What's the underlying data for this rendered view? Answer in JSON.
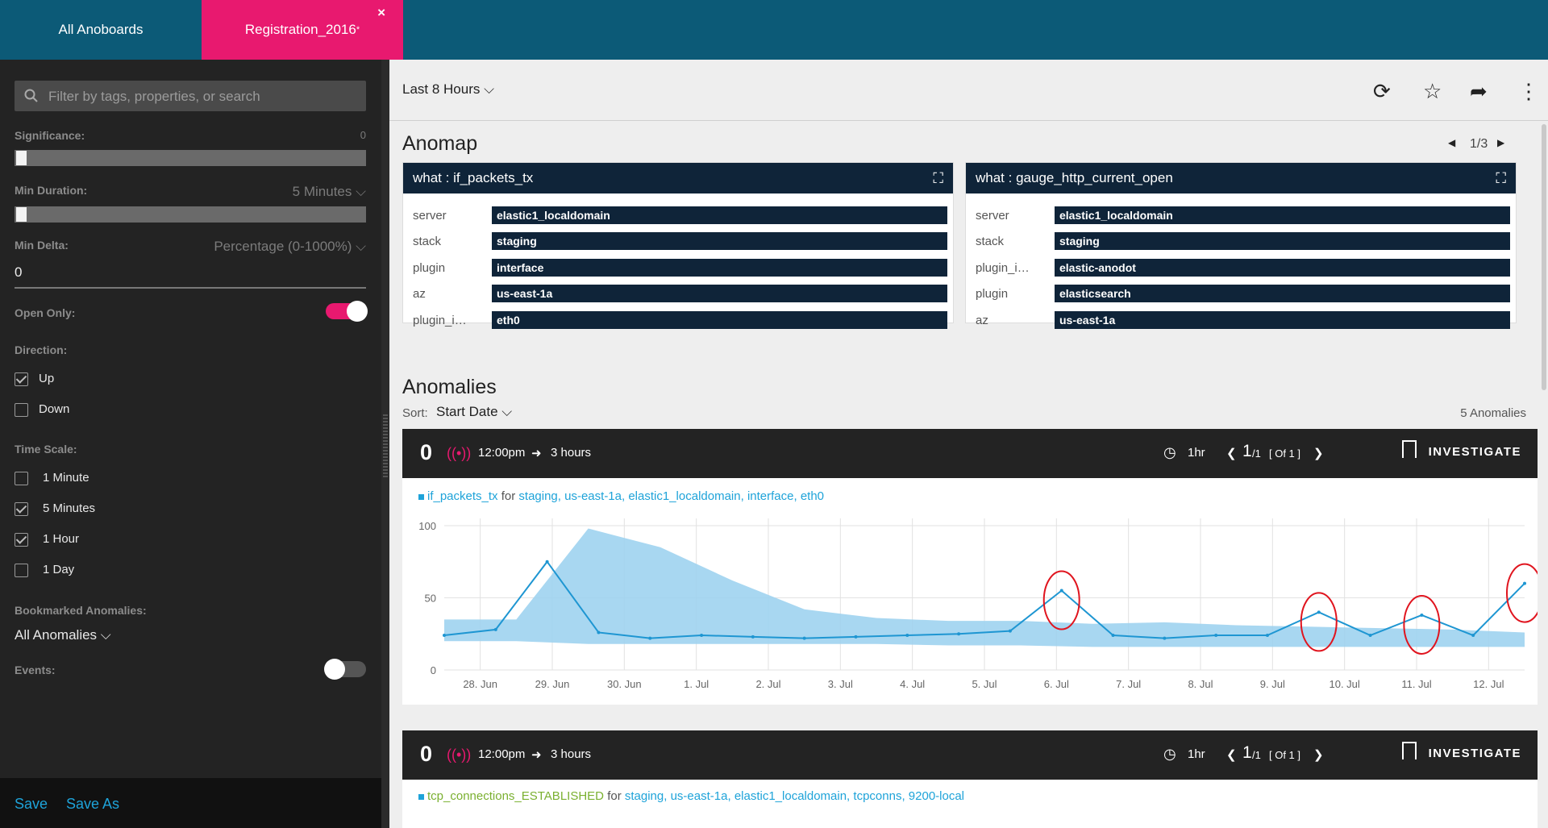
{
  "tabs": {
    "all": "All Anoboards",
    "current": "Registration_2016",
    "current_marker": "*",
    "close": "×"
  },
  "sidebar": {
    "search_placeholder": "Filter by tags, properties, or search",
    "significance_label": "Significance:",
    "significance_value": "0",
    "min_duration_label": "Min Duration:",
    "min_duration_value": "5 Minutes",
    "min_delta_label": "Min Delta:",
    "min_delta_unit": "Percentage (0-1000%)",
    "min_delta_value": "0",
    "open_only_label": "Open Only:",
    "open_only": true,
    "direction_label": "Direction:",
    "direction": [
      {
        "label": "Up",
        "checked": true
      },
      {
        "label": "Down",
        "checked": false
      }
    ],
    "time_scale_label": "Time Scale:",
    "time_scale": [
      {
        "label": "1 Minute",
        "checked": false
      },
      {
        "label": "5 Minutes",
        "checked": true
      },
      {
        "label": "1 Hour",
        "checked": true
      },
      {
        "label": "1 Day",
        "checked": false
      }
    ],
    "bookmarked_label": "Bookmarked Anomalies:",
    "bookmarked_value": "All Anomalies",
    "events_label": "Events:",
    "events": false,
    "save": "Save",
    "save_as": "Save As"
  },
  "toolbar": {
    "range": "Last 8 Hours"
  },
  "anomap": {
    "title": "Anomap",
    "page": "1/3",
    "cards": [
      {
        "title": "what : if_packets_tx",
        "rows": [
          [
            "server",
            "elastic1_localdomain"
          ],
          [
            "stack",
            "staging"
          ],
          [
            "plugin",
            "interface"
          ],
          [
            "az",
            "us-east-1a"
          ],
          [
            "plugin_i…",
            "eth0"
          ]
        ]
      },
      {
        "title": "what : gauge_http_current_open",
        "rows": [
          [
            "server",
            "elastic1_localdomain"
          ],
          [
            "stack",
            "staging"
          ],
          [
            "plugin_i…",
            "elastic-anodot"
          ],
          [
            "plugin",
            "elasticsearch"
          ],
          [
            "az",
            "us-east-1a"
          ]
        ]
      }
    ]
  },
  "anomalies": {
    "title": "Anomalies",
    "sort_label": "Sort:",
    "sort_value": "Start Date",
    "count": "5 Anomalies",
    "items": [
      {
        "score": "0",
        "start": "12:00pm",
        "duration": "3 hours",
        "resolution": "1hr",
        "page": "1",
        "page_of": "/1",
        "page_total": "[ Of 1 ]",
        "action": "INVESTIGATE",
        "metric": "if_packets_tx",
        "for": "for",
        "tags": [
          "staging,",
          "us-east-1a,",
          "elastic1_localdomain,",
          "interface,",
          "eth0"
        ]
      },
      {
        "score": "0",
        "start": "12:00pm",
        "duration": "3 hours",
        "resolution": "1hr",
        "page": "1",
        "page_of": "/1",
        "page_total": "[ Of 1 ]",
        "action": "INVESTIGATE",
        "metric": "tcp_connections_ESTABLISHED",
        "for": "for",
        "tags": [
          "staging,",
          "us-east-1a,",
          "elastic1_localdomain,",
          "tcpconns,",
          "9200-local"
        ]
      }
    ]
  },
  "chart_data": {
    "type": "line",
    "x": [
      "28. Jun",
      "29. Jun",
      "30. Jun",
      "1. Jul",
      "2. Jul",
      "3. Jul",
      "4. Jul",
      "5. Jul",
      "6. Jul",
      "7. Jul",
      "8. Jul",
      "9. Jul",
      "10. Jul",
      "11. Jul",
      "12. Jul"
    ],
    "y_ticks": [
      "0",
      "50",
      "100"
    ],
    "ylim": [
      0,
      105
    ],
    "series": [
      {
        "name": "if_packets_tx",
        "values": [
          24,
          28,
          75,
          26,
          22,
          24,
          23,
          22,
          23,
          24,
          25,
          27,
          55,
          24,
          22,
          24,
          24,
          40,
          24,
          38,
          24,
          60
        ]
      }
    ],
    "baseline_band": {
      "upper": [
        35,
        35,
        98,
        85,
        62,
        42,
        36,
        34,
        34,
        32,
        33,
        31,
        30,
        29,
        28,
        26
      ],
      "lower": [
        20,
        20,
        18,
        18,
        18,
        18,
        18,
        17,
        17,
        16,
        16,
        16,
        16,
        16,
        16,
        16
      ]
    },
    "anomaly_marks": [
      "7. Jul",
      "11. Jul",
      "11. Jul",
      "12. Jul"
    ],
    "colors": {
      "line": "#1e96d2",
      "band": "#9fd3ef",
      "anomaly": "#1f5f86",
      "anomaly_open": "#f0a020",
      "circle": "#e0141e"
    }
  },
  "colors": {
    "topbar": "#0c5a77",
    "accent": "#e8196f",
    "link": "#1ea3d9",
    "dark": "#0f2439"
  }
}
